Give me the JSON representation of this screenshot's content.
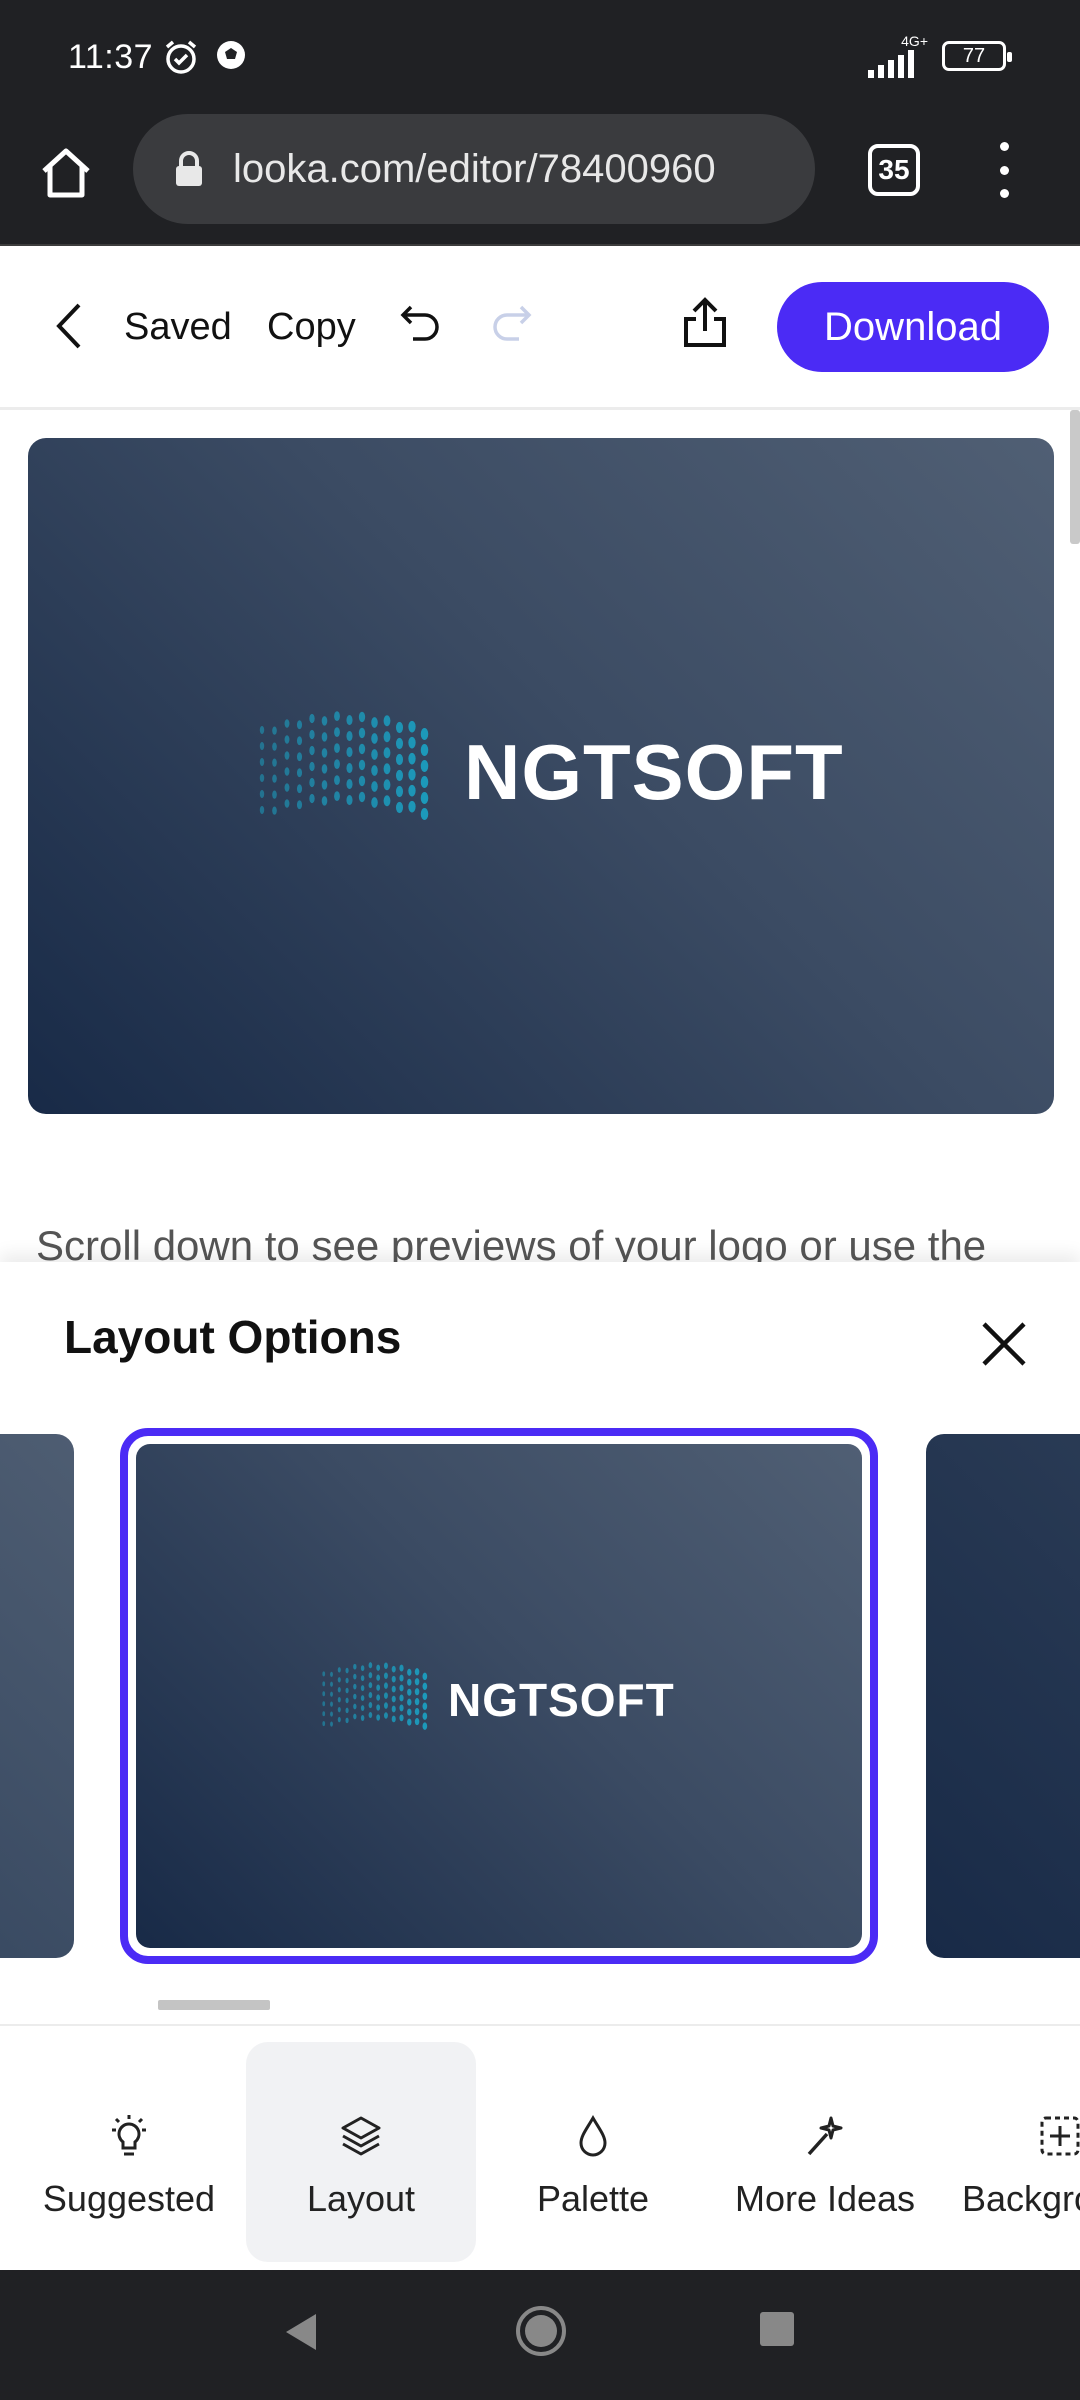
{
  "status_bar": {
    "time": "11:37",
    "network": "4G+",
    "battery": "77",
    "icons": [
      "alarm-icon",
      "soccer-ball-icon",
      "signal-icon",
      "battery-icon"
    ]
  },
  "browser": {
    "url": "looka.com/editor/78400960",
    "tab_count": "35"
  },
  "toolbar": {
    "saved_label": "Saved",
    "copy_label": "Copy",
    "download_label": "Download"
  },
  "preview": {
    "logo_text": "NGTSOFT"
  },
  "scroll_note": "Scroll down to see previews of your logo or use the",
  "sheet": {
    "title": "Layout Options",
    "selected_logo_text": "NGTSOFT"
  },
  "bottom_nav": {
    "items": [
      {
        "label": "Suggested",
        "icon": "lightbulb-icon"
      },
      {
        "label": "Layout",
        "icon": "layers-icon",
        "active": true
      },
      {
        "label": "Palette",
        "icon": "droplet-icon"
      },
      {
        "label": "More Ideas",
        "icon": "magic-wand-icon"
      },
      {
        "label": "Backgro",
        "icon": "grid-plus-icon"
      }
    ]
  },
  "colors": {
    "accent": "#4b2bf5",
    "preview_dark": "#182a47",
    "preview_light": "#505f74",
    "logo_mark": "#1b9ec0"
  }
}
